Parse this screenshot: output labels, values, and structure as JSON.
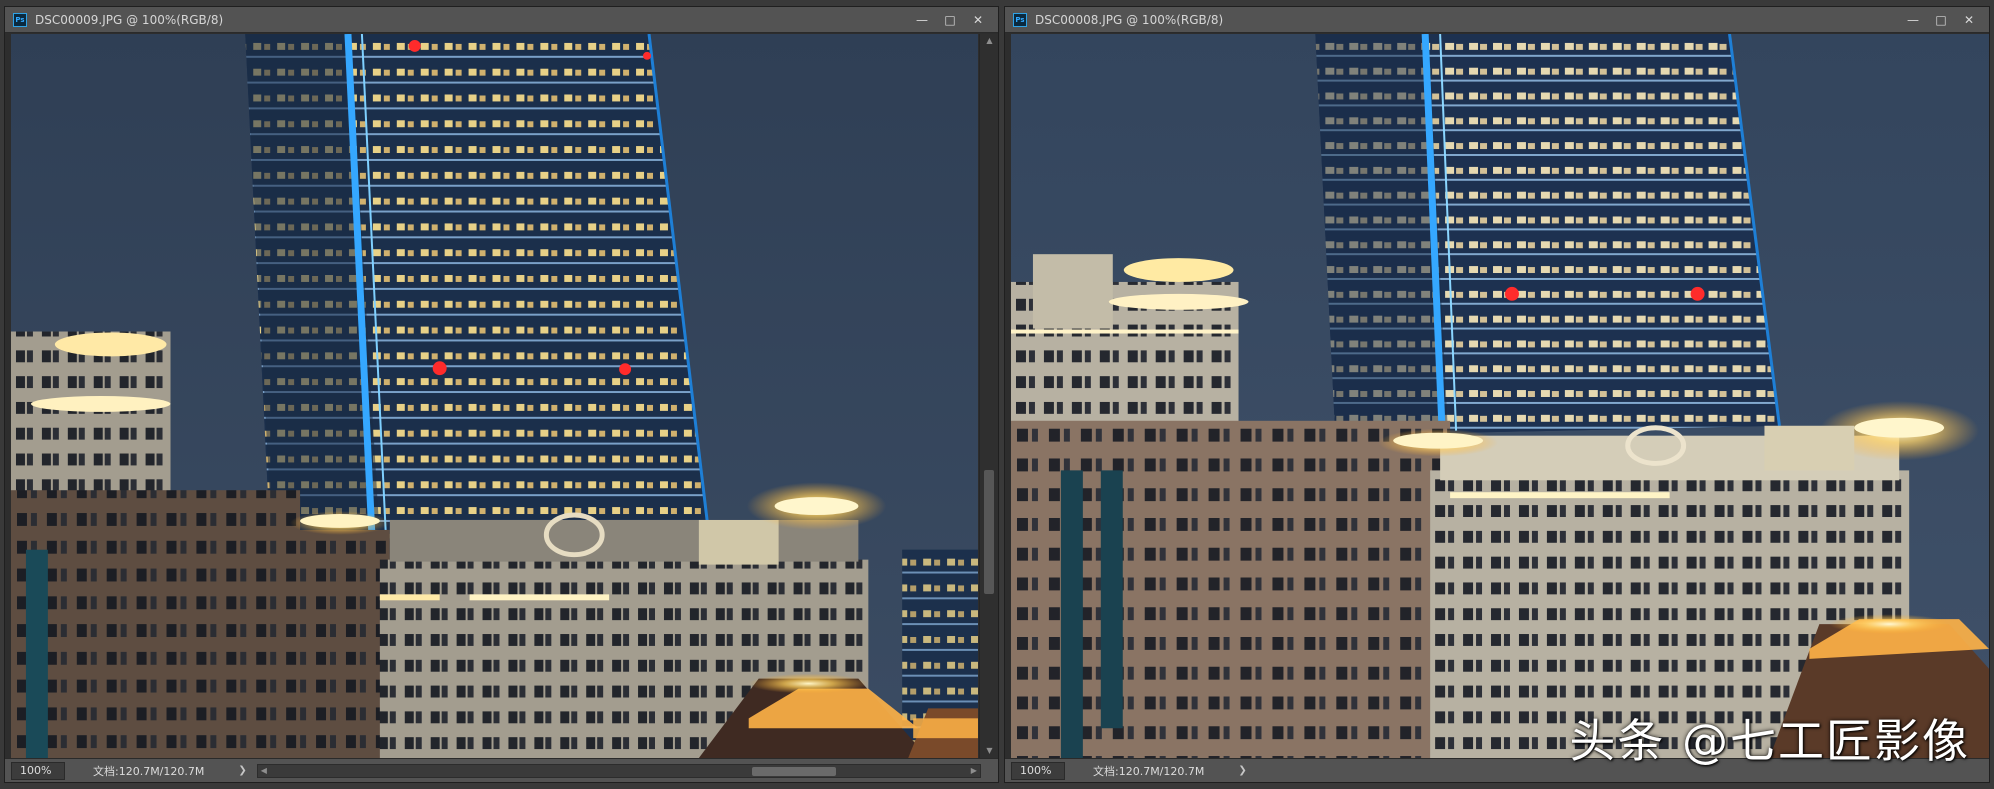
{
  "windows": [
    {
      "app_icon": "Ps",
      "title": "DSC00009.JPG @ 100%(RGB/8)",
      "controls": {
        "minimize": "—",
        "maximize": "□",
        "close": "✕"
      },
      "status": {
        "zoom": "100%",
        "doc_info": "文档:120.7M/120.7M",
        "arrow": "❯"
      },
      "scroll": {
        "up": "▲",
        "down": "▼",
        "left": "◀",
        "right": "▶"
      }
    },
    {
      "app_icon": "Ps",
      "title": "DSC00008.JPG @ 100%(RGB/8)",
      "controls": {
        "minimize": "—",
        "maximize": "□",
        "close": "✕"
      },
      "status": {
        "zoom": "100%",
        "doc_info": "文档:120.7M/120.7M",
        "arrow": "❯"
      }
    }
  ],
  "watermark": "头条 @七工匠影像",
  "colors": {
    "sky": "#34455c",
    "tower_glass": "#1e3350",
    "tower_edge_light": "#35a7ff",
    "window_light": "#f3d98a",
    "building_tan": "#5b4a3f",
    "building_cream": "#9c9789",
    "warm_glow": "#ffcf5a",
    "aircraft_warning_light": "#ff2b2b",
    "ui_title_bar": "#535353"
  }
}
